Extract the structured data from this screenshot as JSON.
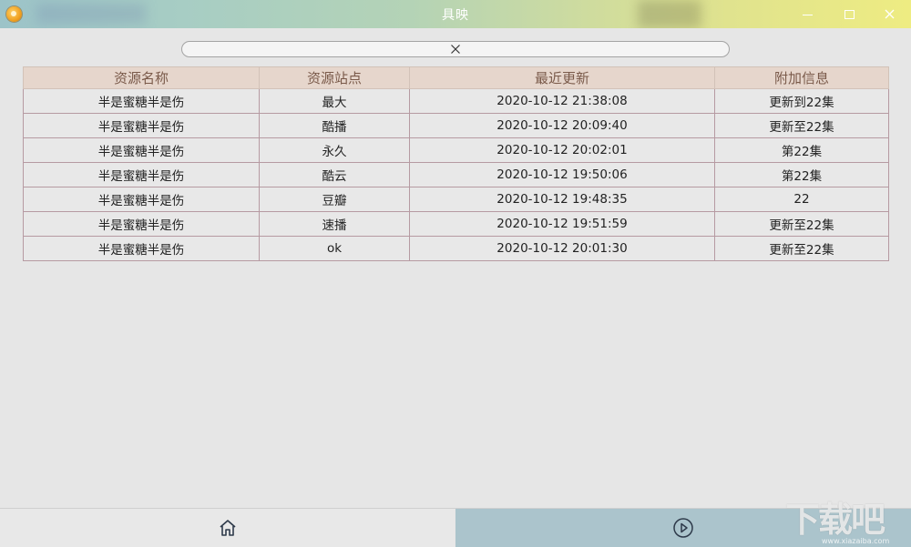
{
  "window": {
    "title": "具映",
    "logo_icon": "app-logo-icon",
    "controls": [
      "minimize-icon",
      "maximize-icon",
      "close-icon"
    ]
  },
  "search": {
    "value": "",
    "placeholder": "",
    "clear_icon": "close-icon"
  },
  "table": {
    "headers": [
      "资源名称",
      "资源站点",
      "最近更新",
      "附加信息"
    ],
    "rows": [
      [
        "半是蜜糖半是伤",
        "最大",
        "2020-10-12 21:38:08",
        "更新到22集"
      ],
      [
        "半是蜜糖半是伤",
        "酷播",
        "2020-10-12 20:09:40",
        "更新至22集"
      ],
      [
        "半是蜜糖半是伤",
        "永久",
        "2020-10-12 20:02:01",
        "第22集"
      ],
      [
        "半是蜜糖半是伤",
        "酷云",
        "2020-10-12 19:50:06",
        "第22集"
      ],
      [
        "半是蜜糖半是伤",
        "豆瓣",
        "2020-10-12 19:48:35",
        "22"
      ],
      [
        "半是蜜糖半是伤",
        "速播",
        "2020-10-12 19:51:59",
        "更新至22集"
      ],
      [
        "半是蜜糖半是伤",
        "ok",
        "2020-10-12 20:01:30",
        "更新至22集"
      ]
    ]
  },
  "bottom_nav": {
    "items": [
      {
        "icon": "home-icon",
        "active": false
      },
      {
        "icon": "play-circle-icon",
        "active": true
      }
    ]
  },
  "watermark": {
    "big": "下载吧",
    "small": "www.xiazaiba.com"
  },
  "colors": {
    "header_bg": "#e6d6cc",
    "header_text": "#7a5a4a",
    "row_border": "#b69aa2",
    "active_tab": "#abc4cc"
  }
}
